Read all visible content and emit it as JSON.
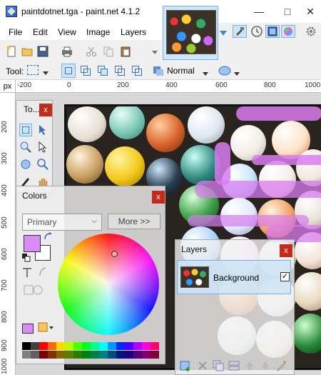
{
  "window": {
    "title": "paintdotnet.tga - paint.net 4.1.2",
    "minimize": "—",
    "maximize": "□"
  },
  "menu": {
    "items": [
      "File",
      "Edit",
      "View",
      "Image",
      "Layers"
    ]
  },
  "toolbar": {
    "tool_label": "Tool:",
    "blend_mode": "Normal"
  },
  "rulers": {
    "unit": "px",
    "top_labels": [
      "-200",
      "0",
      "200",
      "400",
      "600",
      "800",
      "1000"
    ],
    "left_labels": [
      "200",
      "300",
      "400",
      "500",
      "600",
      "700",
      "800",
      "900",
      "1000"
    ]
  },
  "tools_panel": {
    "title": "To...",
    "close": "x"
  },
  "colors_panel": {
    "title": "Colors",
    "close": "x",
    "mode_select": "Primary",
    "more_button": "More >>",
    "primary_color": "#d98cf5",
    "secondary_color": "#ffffff",
    "palette_row1": [
      "#000000",
      "#404040",
      "#ff0000",
      "#ff6a00",
      "#ffd800",
      "#b6ff00",
      "#4cff00",
      "#00ff21",
      "#00ff90",
      "#00ffff",
      "#0094ff",
      "#0026ff",
      "#4800ff",
      "#b200ff",
      "#ff00dc",
      "#ff006e"
    ],
    "palette_row2": [
      "#808080",
      "#606060",
      "#7f0000",
      "#7f3300",
      "#7f6a00",
      "#5b7f00",
      "#267f00",
      "#007f0e",
      "#007f46",
      "#007f7f",
      "#004a7f",
      "#00137f",
      "#21007f",
      "#57007f",
      "#7f006e",
      "#7f0037"
    ]
  },
  "layers_panel": {
    "title": "Layers",
    "close": "x",
    "layers": [
      {
        "name": "Background",
        "visible": "✓"
      }
    ]
  },
  "colors": {
    "accent": "#cce4f7",
    "accent_border": "#7ab0e0",
    "close_red": "#c42b1c",
    "selection_purple": "#d97bf0"
  }
}
